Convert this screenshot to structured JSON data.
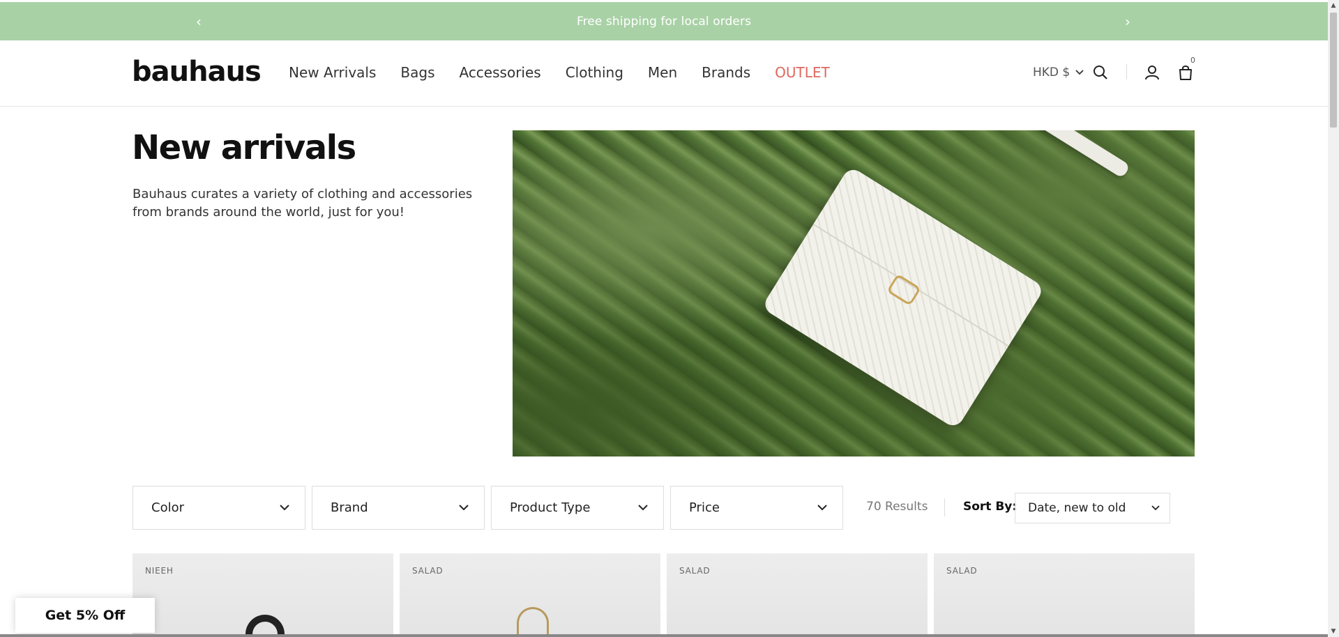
{
  "announcement": {
    "text": "Free shipping for local orders",
    "prev": "‹",
    "next": "›"
  },
  "header": {
    "logo": "bauhaus",
    "nav": [
      "New Arrivals",
      "Bags",
      "Accessories",
      "Clothing",
      "Men",
      "Brands",
      "OUTLET"
    ],
    "currency": "HKD $",
    "cart_count": "0",
    "icons": [
      "search-icon",
      "account-icon",
      "cart-icon"
    ]
  },
  "hero": {
    "title": "New arrivals",
    "description": "Bauhaus curates a variety of clothing and accessories from brands around the world, just for you!"
  },
  "filters": {
    "color": "Color",
    "brand": "Brand",
    "product_type": "Product Type",
    "price": "Price",
    "results": "70 Results",
    "sort_label": "Sort By:",
    "sort_value": "Date, new to old"
  },
  "products": [
    {
      "brand": "NIEEH"
    },
    {
      "brand": "SALAD"
    },
    {
      "brand": "SALAD"
    },
    {
      "brand": "SALAD"
    }
  ],
  "promo": {
    "label": "Get 5% Off"
  },
  "colors": {
    "announce_bg": "#a9d1a6",
    "outlet": "#e0675d"
  }
}
